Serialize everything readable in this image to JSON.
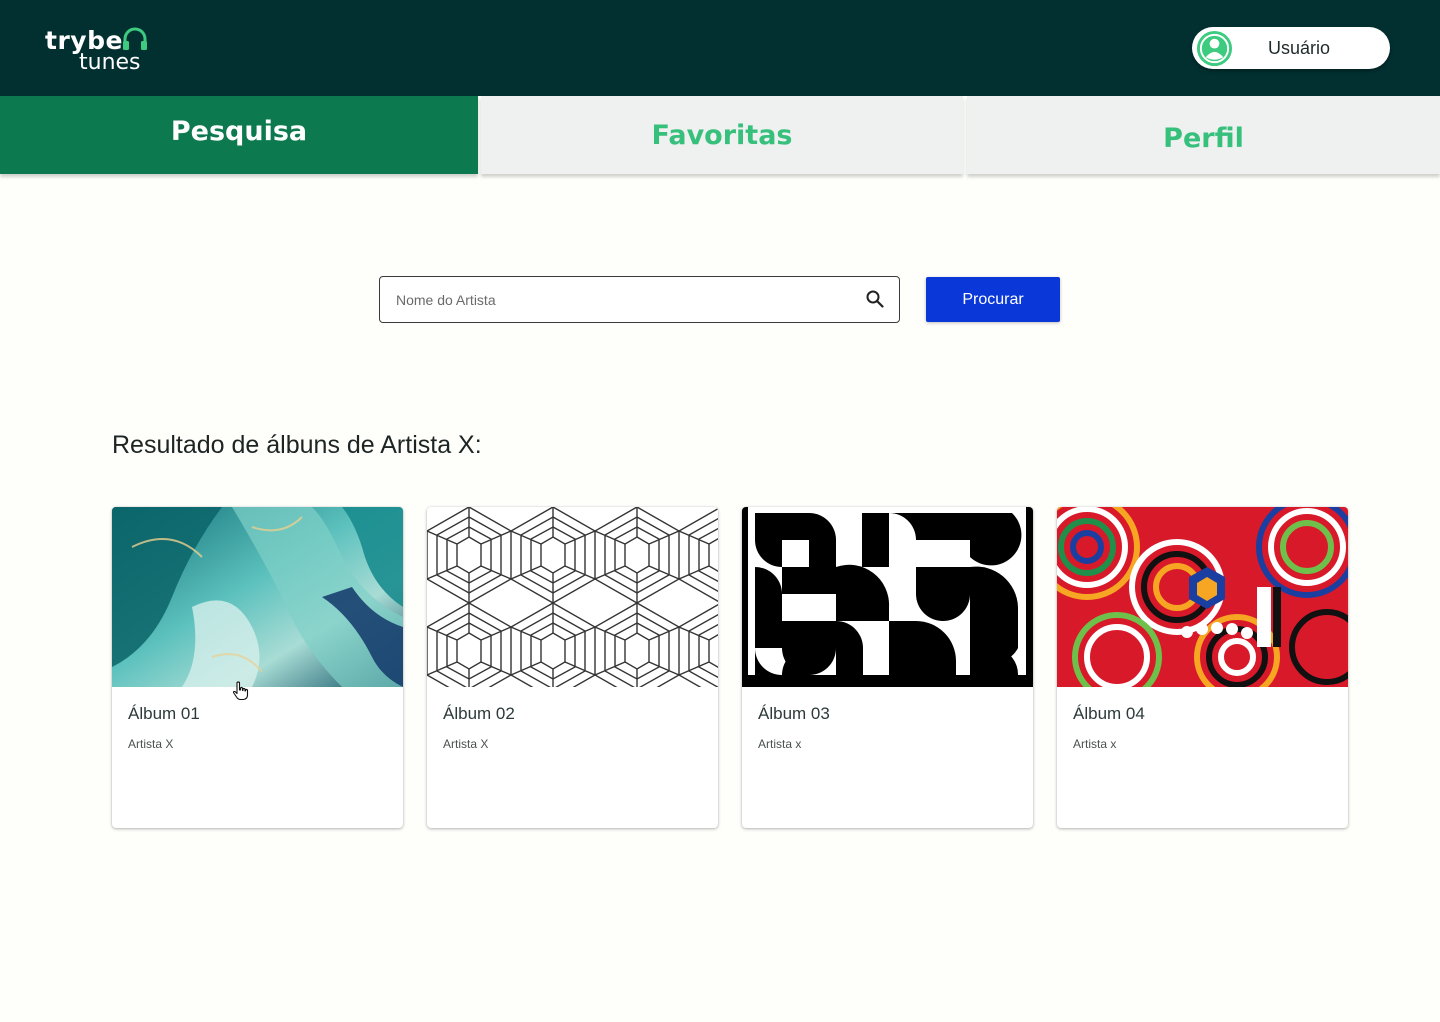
{
  "app": {
    "logo_top": "trybe",
    "logo_bottom": "tunes",
    "user_name": "Usuário"
  },
  "tabs": [
    {
      "label": "Pesquisa",
      "active": true
    },
    {
      "label": "Favoritas",
      "active": false
    },
    {
      "label": "Perfil",
      "active": false
    }
  ],
  "search": {
    "placeholder": "Nome do Artista",
    "value": "",
    "button_label": "Procurar"
  },
  "results": {
    "title": "Resultado de álbuns de Artista X:",
    "albums": [
      {
        "title": "Álbum 01",
        "artist": "Artista X",
        "cover": "teal-marble-art"
      },
      {
        "title": "Álbum 02",
        "artist": "Artista X",
        "cover": "hexagon-line-pattern"
      },
      {
        "title": "Álbum 03",
        "artist": "Artista x",
        "cover": "black-white-geometric"
      },
      {
        "title": "Álbum 04",
        "artist": "Artista x",
        "cover": "colorful-psychedelic-art"
      }
    ]
  },
  "colors": {
    "header_bg": "#023031",
    "active_tab_bg": "#0c7a4e",
    "inactive_tab_text": "#36c07c",
    "button_bg": "#0a37d8"
  }
}
